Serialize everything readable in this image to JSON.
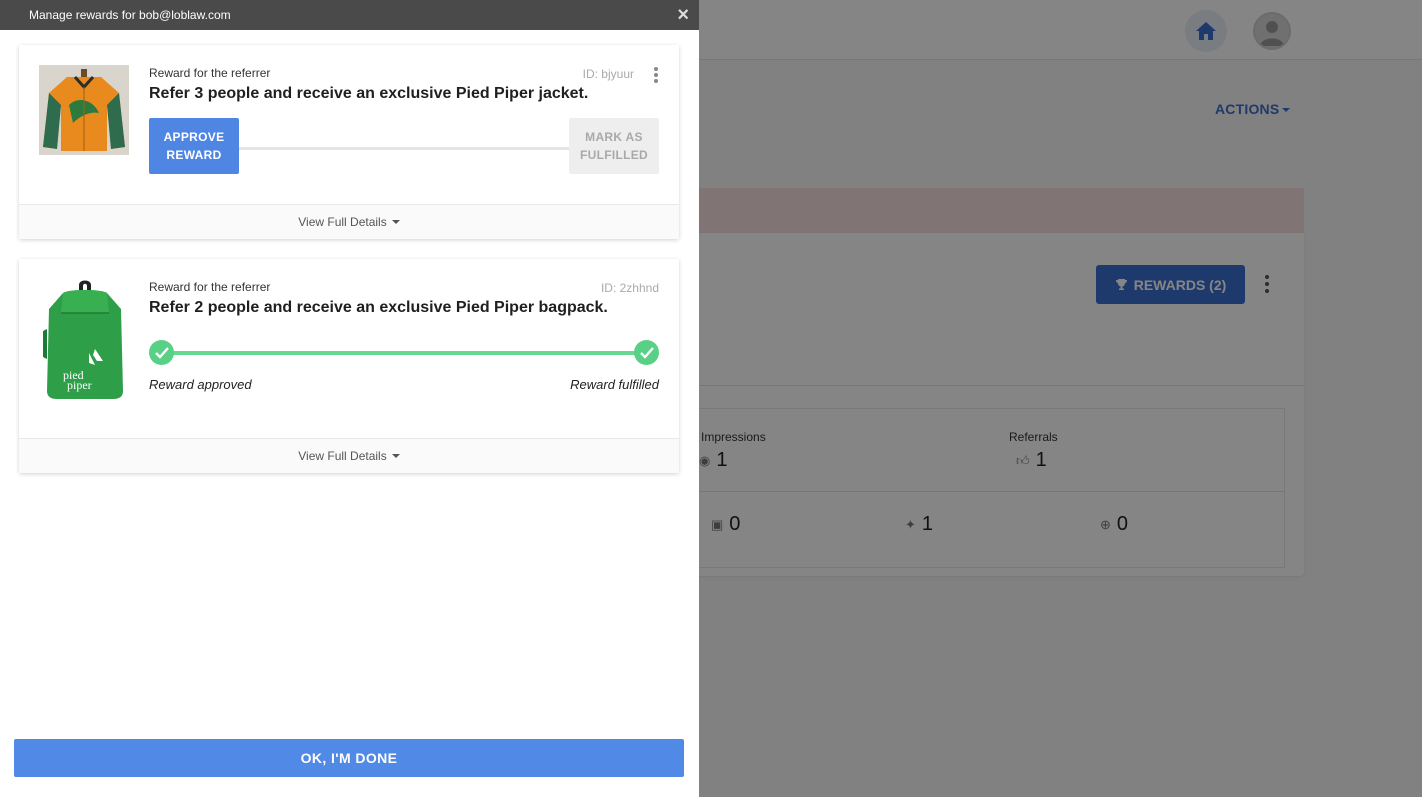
{
  "background": {
    "actions_label": "ACTIONS",
    "rewards_button": "REWARDS (2)",
    "stats": {
      "impressions_label": "Impressions",
      "impressions_value": "1",
      "referrals_label": "Referrals",
      "referrals_value": "1",
      "facebook_value": "0",
      "twitter_value": "1",
      "pinterest_value": "0"
    }
  },
  "modal": {
    "title": "Manage rewards for bob@loblaw.com",
    "close_glyph": "×",
    "rewards": [
      {
        "label": "Reward for the referrer",
        "id": "ID: bjyuur",
        "title": "Refer 3 people and receive an exclusive Pied Piper jacket.",
        "approve_label_line1": "APPROVE",
        "approve_label_line2": "REWARD",
        "fulfill_label_line1": "MARK AS",
        "fulfill_label_line2": "FULFILLED",
        "footer": "View Full Details"
      },
      {
        "label": "Reward for the referrer",
        "id": "ID: 2zhhnd",
        "title": "Refer 2 people and receive an exclusive Pied Piper bagpack.",
        "status_approved": "Reward approved",
        "status_fulfilled": "Reward fulfilled",
        "bag_logo_line1": "pied",
        "bag_logo_line2": "piper",
        "footer": "View Full Details"
      }
    ],
    "done_button": "OK, I'M DONE"
  },
  "colors": {
    "primary": "#4f86e3",
    "success": "#58d086",
    "header_bg": "#4a4a4a"
  }
}
